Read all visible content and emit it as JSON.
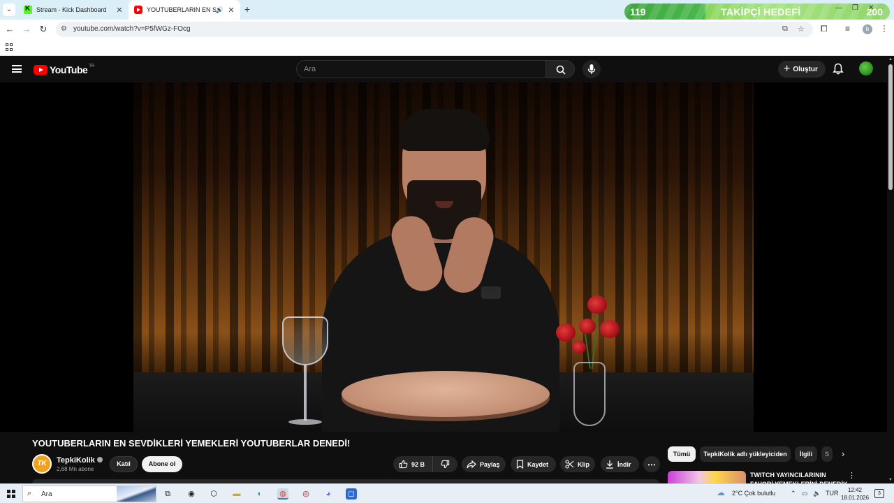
{
  "browser": {
    "tabs": [
      {
        "title": "Stream - Kick Dashboard",
        "active": false
      },
      {
        "title": "YOUTUBERLARIN EN SEVDİ",
        "active": true
      }
    ],
    "url": "youtube.com/watch?v=P5fWGz-FOcg",
    "profile_initial": "b"
  },
  "overlay": {
    "current": "119",
    "title": "TAKİPÇİ HEDEFİ",
    "goal": "200",
    "progress_fraction": 0.595
  },
  "youtube": {
    "logo_text": "YouTube",
    "region": "TR",
    "search_placeholder": "Ara",
    "create_label": "Oluştur"
  },
  "video": {
    "title": "YOUTUBERLARIN EN SEVDİKLERİ YEMEKLERİ YOUTUBERLAR DENEDİ!",
    "channel": {
      "name": "TepkiKolik",
      "avatar_text": "TK",
      "subscribers": "2,68 Mn abone"
    },
    "join_label": "Katıl",
    "subscribe_label": "Abone ol",
    "like_count": "92 B",
    "share_label": "Paylaş",
    "save_label": "Kaydet",
    "clip_label": "Klip",
    "download_label": "İndir"
  },
  "sidebar": {
    "chips": [
      "Tümü",
      "TepkiKolik adlı yükleyiciden",
      "İlgili",
      "S"
    ],
    "recommended": [
      {
        "title": "TWITCH YAYINCILARININ FAVORİ YEMEKLERİNİ DENEDİK"
      }
    ]
  },
  "taskbar": {
    "search_text": "Ara",
    "weather": "2°C  Çok bulutlu",
    "language": "TUR",
    "time": "12:42",
    "date": "18.01.2026",
    "notification_count": "3"
  },
  "colors": {
    "yt_bg": "#0f0f0f",
    "yt_red": "#ff0000",
    "overlay_green": "#49b84d",
    "kick_green": "#53fc18"
  }
}
